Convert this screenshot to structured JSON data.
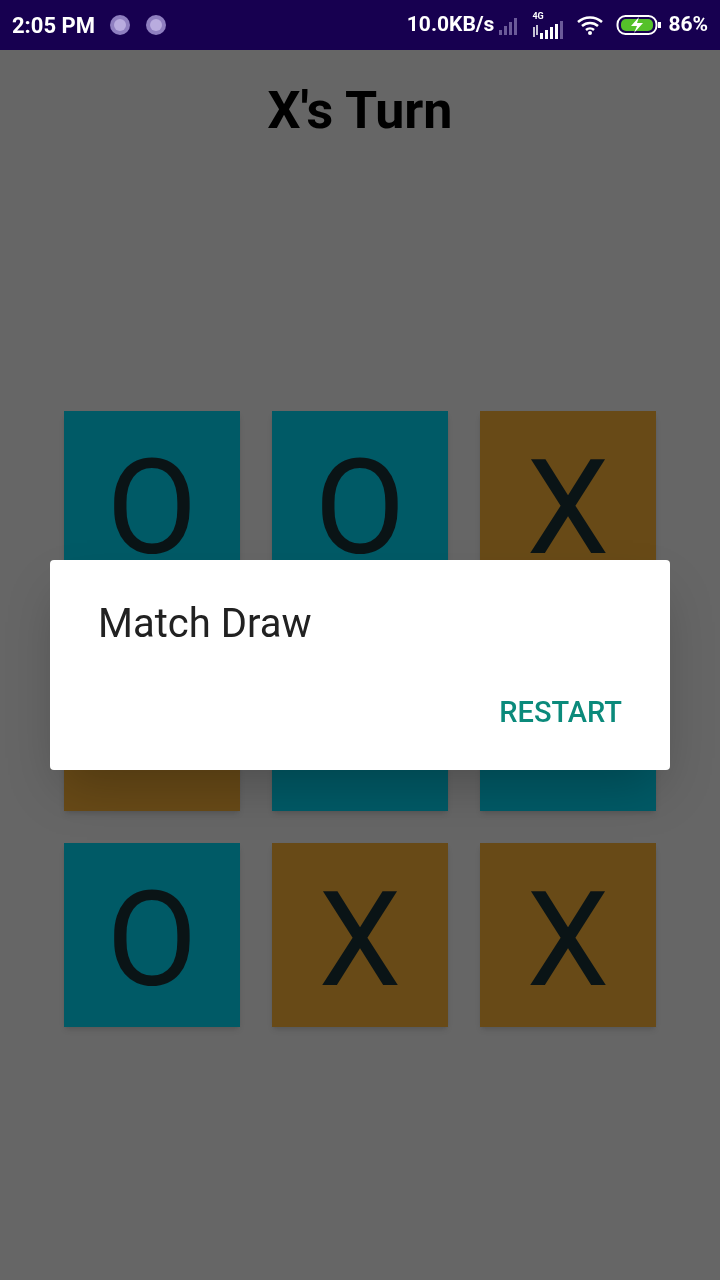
{
  "status_bar": {
    "time": "2:05 PM",
    "speed": "10.0KB/s",
    "network": "4G",
    "battery": "86%"
  },
  "title": "X's Turn",
  "board": [
    {
      "kind": "o",
      "text": "O"
    },
    {
      "kind": "o",
      "text": "O"
    },
    {
      "kind": "x",
      "text": "X"
    },
    {
      "kind": "x"
    },
    {
      "kind": "o"
    },
    {
      "kind": "o"
    },
    {
      "kind": "o",
      "text": "O"
    },
    {
      "kind": "x",
      "text": "X"
    },
    {
      "kind": "x",
      "text": "X"
    }
  ],
  "dialog": {
    "message": "Match Draw",
    "button": "RESTART"
  }
}
